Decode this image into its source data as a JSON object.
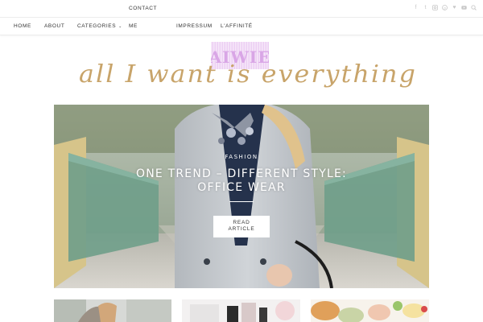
{
  "topbar": {
    "contact_label": "CONTACT",
    "social_icons": [
      "facebook-icon",
      "twitter-icon",
      "instagram-icon",
      "pinterest-icon",
      "bloglovin-heart-icon",
      "youtube-icon",
      "search-icon"
    ]
  },
  "nav": {
    "home": "HOME",
    "about": "ABOUT",
    "categories": "CATEGORIES",
    "me": "ME",
    "impressum": "IMPRESSUM",
    "laffinite": "L'AFFINITÉ"
  },
  "logo": {
    "tagline": "all I want is everything",
    "badge_text": "AIWIE",
    "badge_color": "#d9a6e6"
  },
  "hero": {
    "category": "FASHION",
    "title_line1": "ONE TREND – DIFFERENT STYLE:",
    "title_line2": "OFFICE WEAR",
    "button_line1": "READ",
    "button_line2": "ARTICLE"
  },
  "colors": {
    "accent_gold": "#c8a46a",
    "nav_text": "#333333",
    "social_icon": "#c9c9c9"
  }
}
